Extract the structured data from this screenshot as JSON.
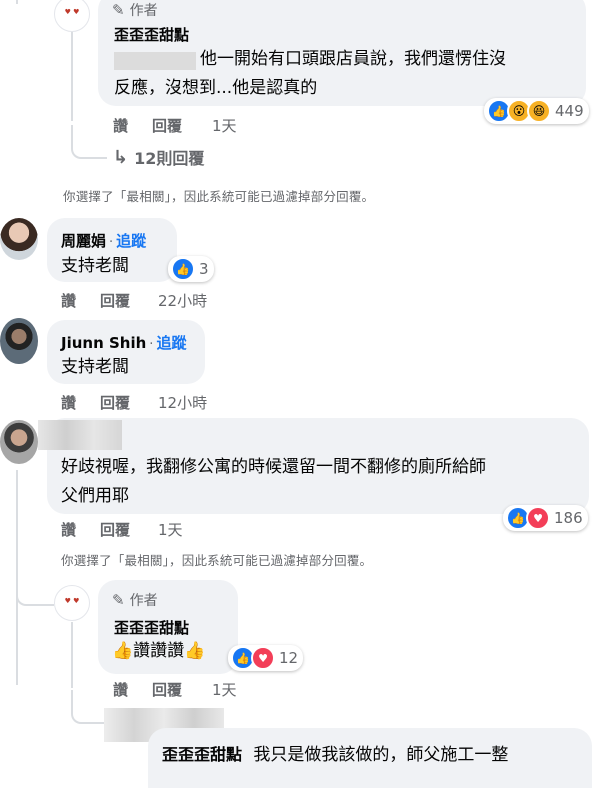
{
  "author_badge": "作者",
  "actions": {
    "like": "讚",
    "reply": "回覆"
  },
  "notice_text": "你選擇了「最相關」，因此系統可能已過濾掉部分回覆。",
  "c1": {
    "name": "歪歪歪甜點",
    "text_line1": "他一開始有口頭跟店員說，我們還愣住沒",
    "text_line2": "反應，沒想到...他是認真的",
    "time": "1天",
    "reactions": {
      "icons": [
        "like-icon",
        "wow-icon",
        "haha-icon"
      ],
      "count": "449"
    },
    "replies_link": "12則回覆"
  },
  "c2": {
    "name": "周麗娟",
    "follow": "追蹤",
    "text": "支持老闆",
    "time": "22小時",
    "reactions": {
      "icons": [
        "like-icon"
      ],
      "count": "3"
    }
  },
  "c3": {
    "name": "Jiunn Shih",
    "follow": "追蹤",
    "text": "支持老闆",
    "time": "12小時"
  },
  "c4": {
    "text_line1": "好歧視喔，我翻修公寓的時候還留一間不翻修的廁所給師",
    "text_line2": "父們用耶",
    "time": "1天",
    "reactions": {
      "icons": [
        "like-icon",
        "love-icon"
      ],
      "count": "186"
    }
  },
  "c5": {
    "name": "歪歪歪甜點",
    "text": "👍讚讚讚👍",
    "time": "1天",
    "reactions": {
      "icons": [
        "like-icon",
        "love-icon"
      ],
      "count": "12"
    }
  },
  "c6": {
    "mention": "歪歪歪甜點",
    "text": "我只是做我該做的，師父施工一整"
  },
  "colors": {
    "like": "#1877f2",
    "love": "#f33e58",
    "wow": "#f7b125",
    "accent": "#1877f2"
  }
}
